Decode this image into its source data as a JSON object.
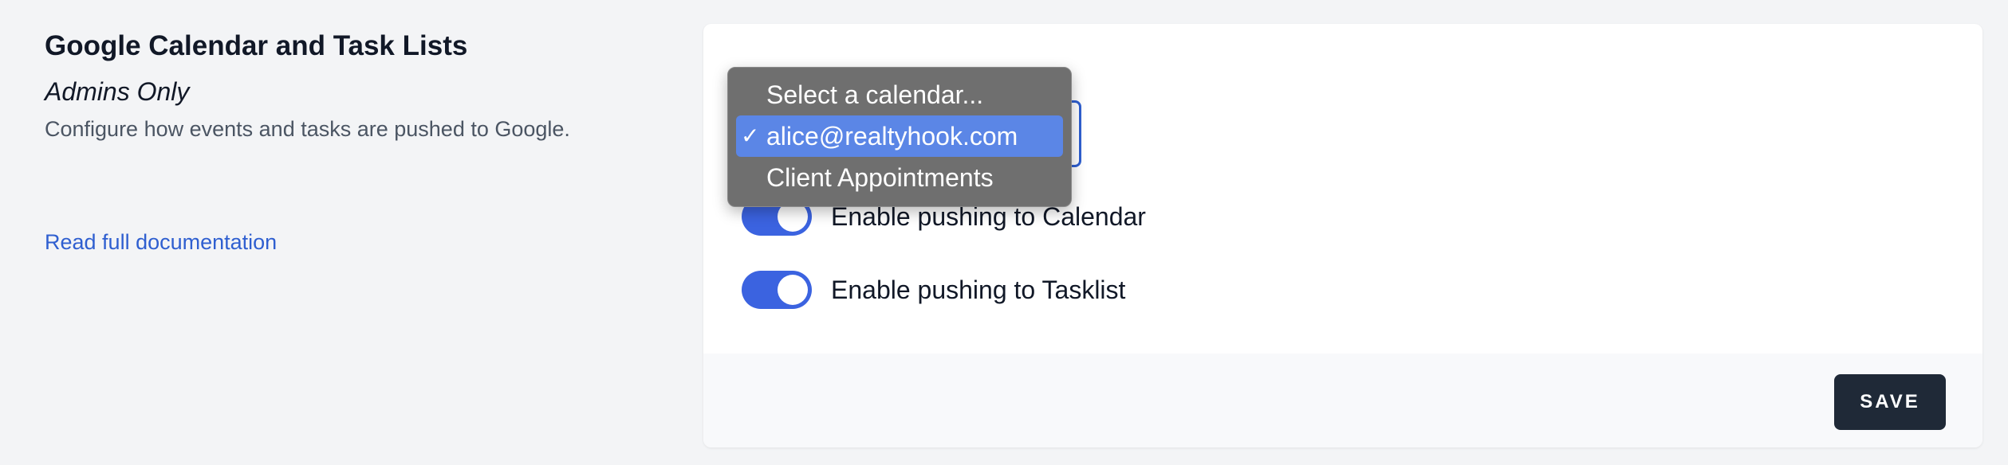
{
  "section": {
    "title": "Google Calendar and Task Lists",
    "subtitle": "Admins Only",
    "description": "Configure how events and tasks are pushed to Google.",
    "doc_link": "Read full documentation"
  },
  "calendar_select": {
    "options": [
      "Select a calendar...",
      "alice@realtyhook.com",
      "Client Appointments"
    ],
    "selected": "alice@realtyhook.com",
    "check_glyph": "✓"
  },
  "toggles": [
    {
      "label": "Enable pushing to Calendar",
      "on": true
    },
    {
      "label": "Enable pushing to Tasklist",
      "on": true
    }
  ],
  "footer": {
    "save_label": "SAVE"
  },
  "colors": {
    "accent": "#3b63e0",
    "button": "#1f2937",
    "link": "#2f5fd0"
  }
}
